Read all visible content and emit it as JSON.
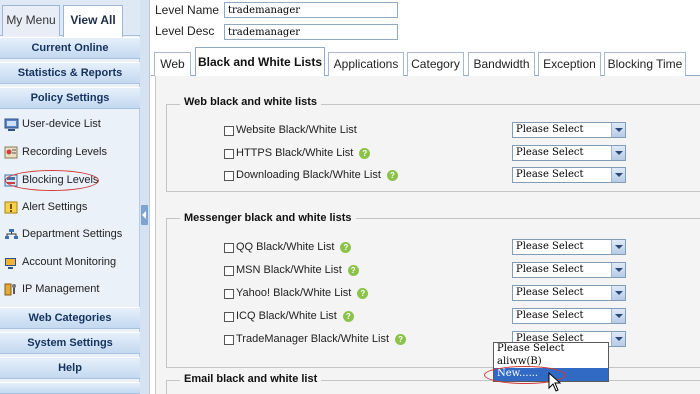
{
  "sidebar": {
    "tabs": [
      {
        "label": "My Menu"
      },
      {
        "label": "View All"
      }
    ],
    "categories": {
      "current_online": "Current Online",
      "statistics": "Statistics & Reports",
      "policy": "Policy Settings",
      "web_categories": "Web Categories",
      "system": "System Settings",
      "help": "Help"
    },
    "items": [
      {
        "label": "User-device List",
        "icon": "user-device-list-icon"
      },
      {
        "label": "Recording Levels",
        "icon": "recording-levels-icon"
      },
      {
        "label": "Blocking Levels",
        "icon": "blocking-levels-icon"
      },
      {
        "label": "Alert Settings",
        "icon": "alert-settings-icon"
      },
      {
        "label": "Department Settings",
        "icon": "department-settings-icon"
      },
      {
        "label": "Account Monitoring",
        "icon": "account-monitoring-icon"
      },
      {
        "label": "IP Management",
        "icon": "ip-management-icon"
      }
    ]
  },
  "form": {
    "level_name_label": "Level Name",
    "level_name_value": "trademanager",
    "level_desc_label": "Level Desc",
    "level_desc_value": "trademanager"
  },
  "tabs": [
    {
      "label": "Web"
    },
    {
      "label": "Black and White Lists",
      "active": true
    },
    {
      "label": "Applications"
    },
    {
      "label": "Category"
    },
    {
      "label": "Bandwidth"
    },
    {
      "label": "Exception"
    },
    {
      "label": "Blocking Time"
    }
  ],
  "sections": {
    "web": {
      "title": "Web black and white lists",
      "rows": [
        {
          "label": "Website Black/White List",
          "value": "Please Select",
          "help": false
        },
        {
          "label": "HTTPS Black/White List",
          "value": "Please Select",
          "help": true
        },
        {
          "label": "Downloading Black/White List",
          "value": "Please Select",
          "help": true
        }
      ]
    },
    "messenger": {
      "title": "Messenger black and white lists",
      "rows": [
        {
          "label": "QQ Black/White List",
          "value": "Please Select",
          "help": true
        },
        {
          "label": "MSN Black/White List",
          "value": "Please Select",
          "help": true
        },
        {
          "label": "Yahoo! Black/White List",
          "value": "Please Select",
          "help": true
        },
        {
          "label": "ICQ Black/White List",
          "value": "Please Select",
          "help": true
        },
        {
          "label": "TradeManager Black/White List",
          "value": "Please Select",
          "help": true
        }
      ]
    },
    "email": {
      "title": "Email black and white list"
    }
  },
  "dropdown": {
    "options": [
      "Please Select",
      "aliww(B)",
      "New......"
    ],
    "selected": "New......"
  },
  "help_glyph": "?",
  "colors": {
    "accent": "#316ac5",
    "highlight_ring": "#d03a3a",
    "help_icon": "#8bc34a",
    "sidebar_category": "#14325e"
  }
}
